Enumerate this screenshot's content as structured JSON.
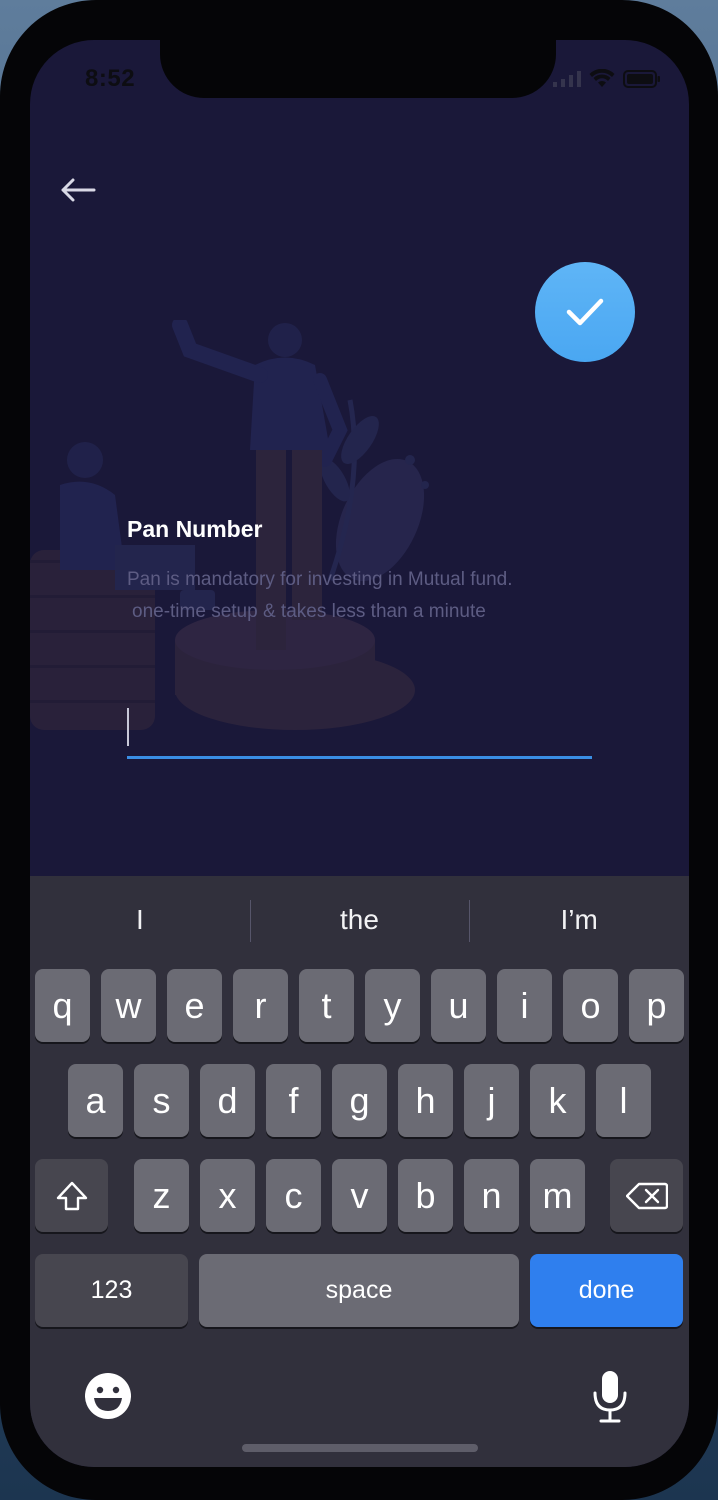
{
  "status_bar": {
    "time": "8:52",
    "icons": [
      "cellular-signal-icon",
      "wifi-icon",
      "battery-icon"
    ]
  },
  "navigation": {
    "back_icon": "arrow-left-icon"
  },
  "confirm_button": {
    "icon": "checkmark-icon",
    "color": "#4fabf4"
  },
  "form": {
    "title": "Pan Number",
    "description_line1": "Pan is mandatory for investing in Mutual fund.",
    "description_line2": "one-time setup & takes less than a minute",
    "input_value": ""
  },
  "keyboard": {
    "suggestions": [
      "I",
      "the",
      "I’m"
    ],
    "row1": [
      "q",
      "w",
      "e",
      "r",
      "t",
      "y",
      "u",
      "i",
      "o",
      "p"
    ],
    "row2": [
      "a",
      "s",
      "d",
      "f",
      "g",
      "h",
      "j",
      "k",
      "l"
    ],
    "row3": [
      "z",
      "x",
      "c",
      "v",
      "b",
      "n",
      "m"
    ],
    "shift_icon": "shift-icon",
    "backspace_icon": "backspace-icon",
    "numbers_label": "123",
    "space_label": "space",
    "done_label": "done",
    "emoji_icon": "emoji-icon",
    "mic_icon": "microphone-icon"
  },
  "colors": {
    "background": "#1a1839",
    "accent": "#2f7fee",
    "input_underline": "#3a8ee4"
  }
}
